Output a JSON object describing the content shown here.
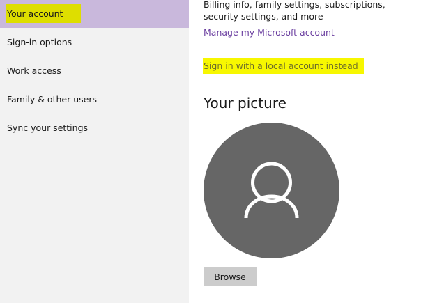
{
  "sidebar": {
    "items": [
      {
        "label": "Your account"
      },
      {
        "label": "Sign-in options"
      },
      {
        "label": "Work access"
      },
      {
        "label": "Family & other users"
      },
      {
        "label": "Sync your settings"
      }
    ]
  },
  "main": {
    "billing_text": "Billing info, family settings, subscriptions, security settings, and more",
    "manage_link": "Manage my Microsoft account",
    "local_account_link": "Sign in with a local account instead",
    "picture_heading": "Your picture",
    "avatar_icon": "user-silhouette-icon",
    "browse_label": "Browse"
  },
  "colors": {
    "sidebar_bg": "#f2f2f2",
    "active_item_bg": "#c9b8dc",
    "highlight_yellow": "#dede00",
    "link_purple": "#6b3fa0",
    "avatar_bg": "#666666",
    "button_bg": "#cccccc"
  }
}
